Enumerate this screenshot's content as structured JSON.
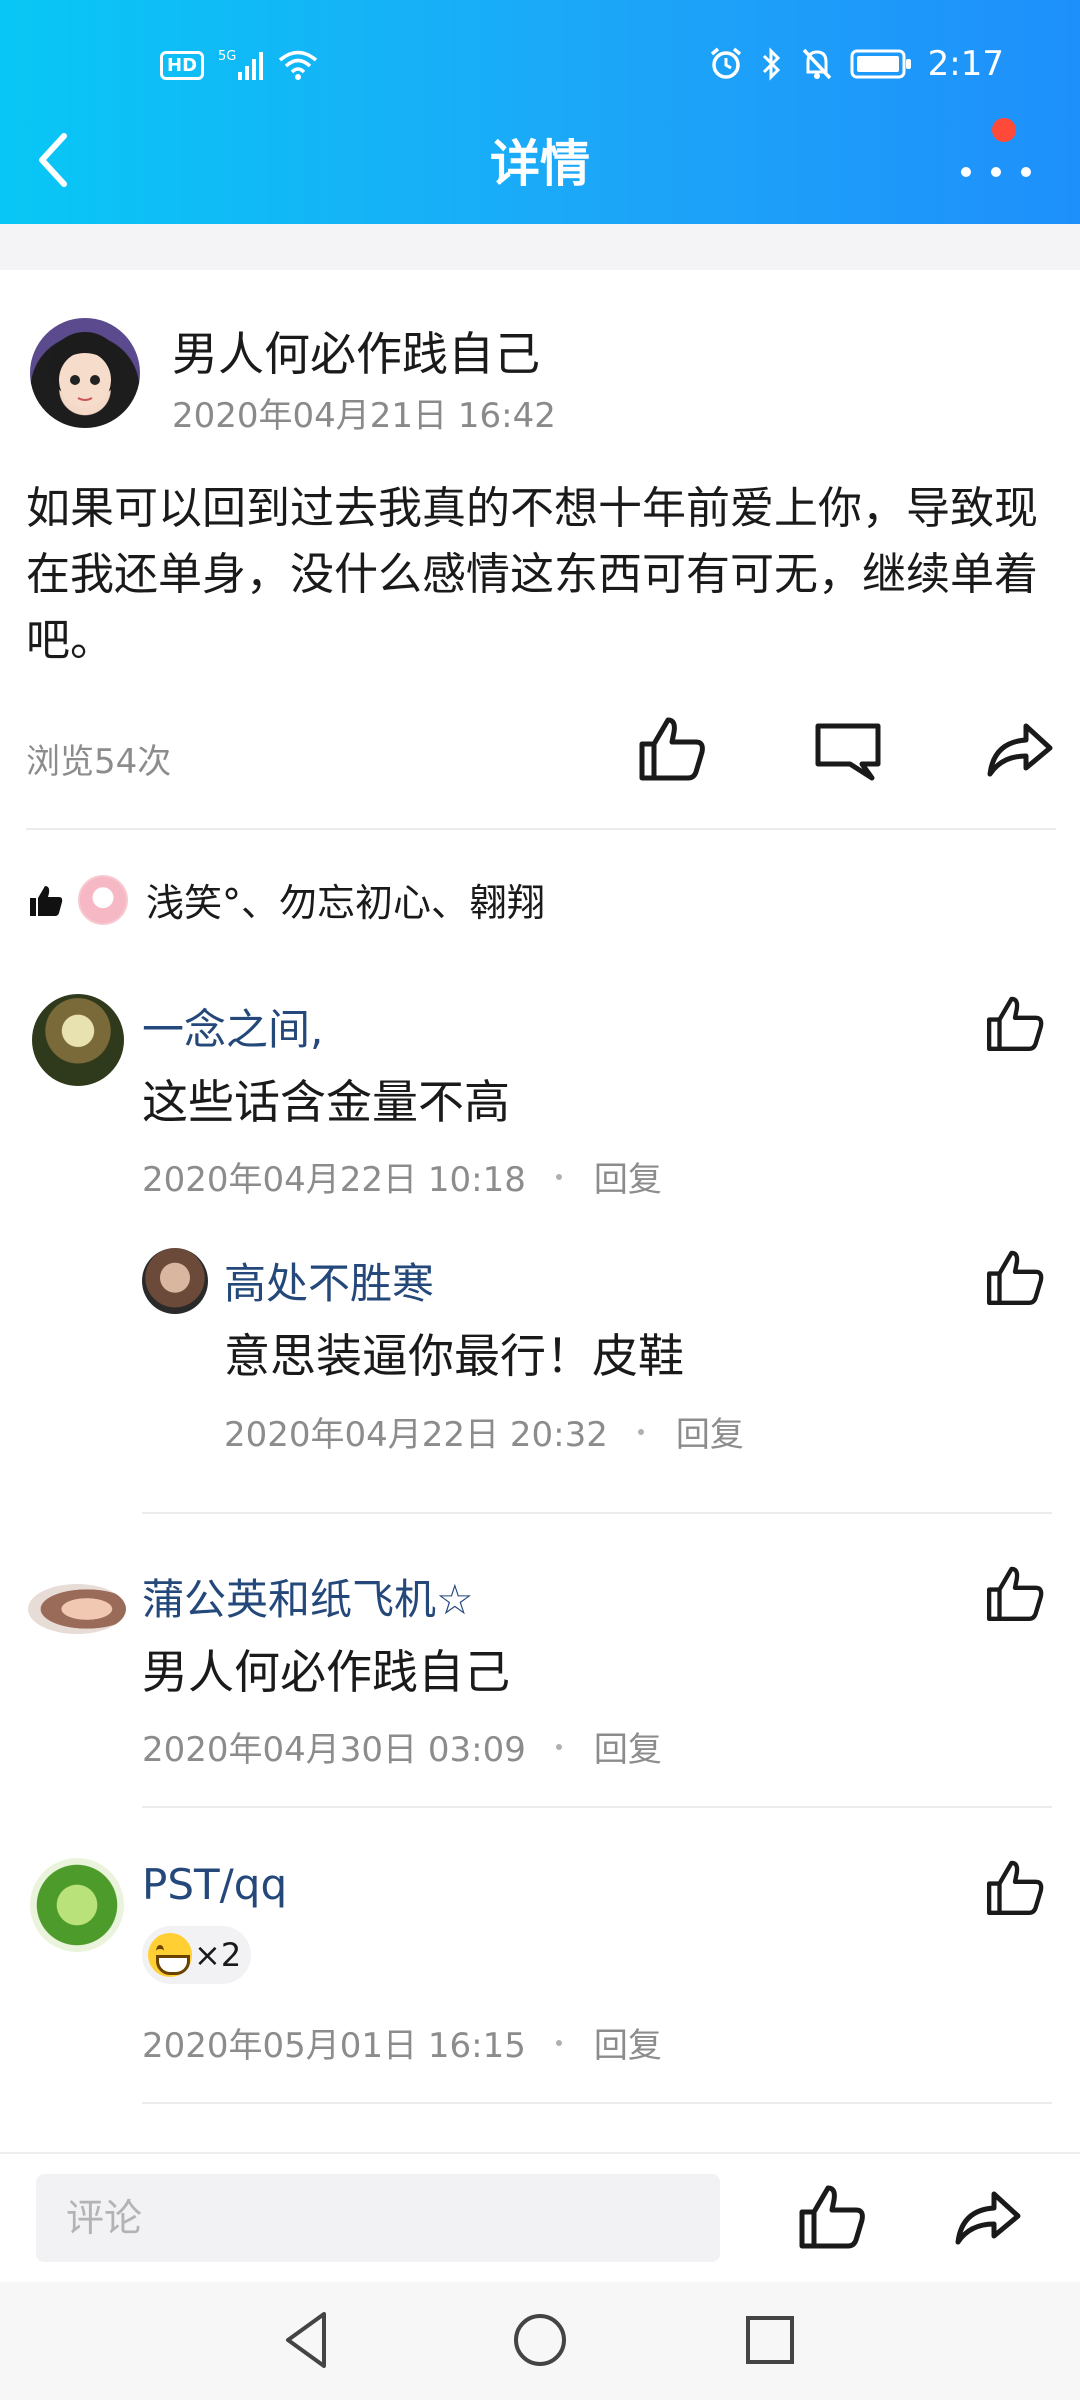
{
  "status_bar": {
    "hd": "HD",
    "network": "5G",
    "time": "2:17"
  },
  "nav": {
    "title": "详情"
  },
  "post": {
    "author": "男人何必作践自己",
    "date": "2020年04月21日 16:42",
    "body": "如果可以回到过去我真的不想十年前爱上你，导致现在我还单身，没什么感情这东西可有可无，继续单着吧。",
    "views": "浏览54次"
  },
  "likes": {
    "text": "浅笑°、勿忘初心、翱翔"
  },
  "comments": [
    {
      "name": "一念之间,",
      "text": "这些话含金量不高",
      "time": "2020年04月22日 10:18",
      "reply": "回复"
    },
    {
      "name": "高处不胜寒",
      "text": "意思装逼你最行！皮鞋",
      "time": "2020年04月22日 20:32",
      "reply": "回复"
    },
    {
      "name": "蒲公英和纸飞机☆",
      "text": "男人何必作践自己",
      "time": "2020年04月30日 03:09",
      "reply": "回复"
    },
    {
      "name": "PST/qq",
      "emoji_count": "×2",
      "time": "2020年05月01日 16:15",
      "reply": "回复"
    }
  ],
  "bottom": {
    "placeholder": "评论"
  },
  "icons": {
    "back": "chevron-left-icon",
    "more": "more-dots-icon",
    "like": "thumbs-up-icon",
    "comment": "comment-bubble-icon",
    "share": "share-arrow-icon",
    "sys_back": "triangle-back-icon",
    "sys_home": "circle-home-icon",
    "sys_recent": "square-recent-icon"
  },
  "colors": {
    "header_start": "#08c7f5",
    "header_end": "#1e90fb",
    "name_blue": "#24487a",
    "badge_red": "#ff4a3a"
  }
}
